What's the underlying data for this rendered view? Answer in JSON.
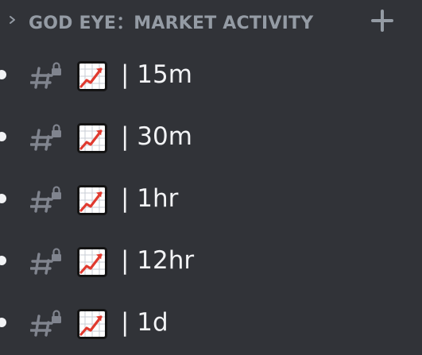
{
  "category": {
    "title": "GOD EYE：MARKET ACTIVITY",
    "collapse_icon": "chevron-right-icon",
    "add_icon": "plus-icon"
  },
  "channels": [
    {
      "label": "| 15m",
      "icon": "locked-text-channel-icon",
      "emoji": "chart-increasing-emoji"
    },
    {
      "label": "| 30m",
      "icon": "locked-text-channel-icon",
      "emoji": "chart-increasing-emoji"
    },
    {
      "label": "| 1hr",
      "icon": "locked-text-channel-icon",
      "emoji": "chart-increasing-emoji"
    },
    {
      "label": "| 12hr",
      "icon": "locked-text-channel-icon",
      "emoji": "chart-increasing-emoji"
    },
    {
      "label": "| 1d",
      "icon": "locked-text-channel-icon",
      "emoji": "chart-increasing-emoji"
    }
  ],
  "colors": {
    "background": "#313338",
    "muted_text": "#949ba4",
    "channel_text": "#f2f3f5",
    "chart_line": "#e03a2f"
  }
}
